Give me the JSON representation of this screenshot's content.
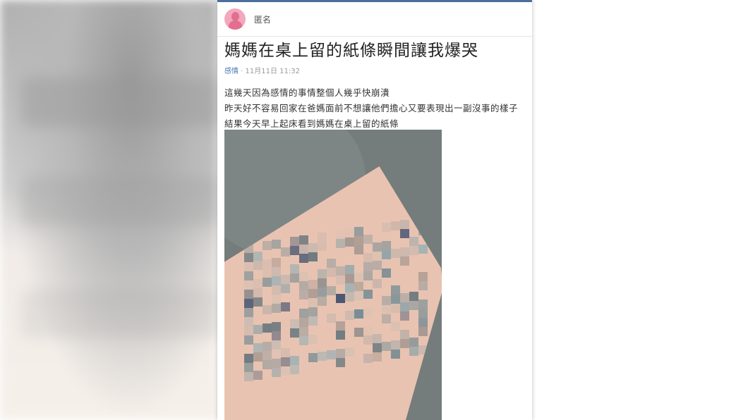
{
  "post": {
    "author": "匿名",
    "title": "媽媽在桌上留的紙條瞬間讓我爆哭",
    "category": "感情",
    "date": "11月11日 11:32",
    "content_lines": [
      "這幾天因為感情的事情整個人幾乎快崩潰",
      "昨天好不容易回家在爸媽面前不想讓他們擔心又要表現出一副沒事的樣子",
      "結果今天早上起床看到媽媽在桌上留的紙條"
    ]
  },
  "colors": {
    "top_accent": "#4c6e99",
    "avatar": "#f3a8bd",
    "category_link": "#4d79b3",
    "photo_background": "#757c7c",
    "paper": "#e9c3b1"
  },
  "icons": {
    "avatar": "female-avatar-icon"
  },
  "image": {
    "description_hidden": true
  }
}
